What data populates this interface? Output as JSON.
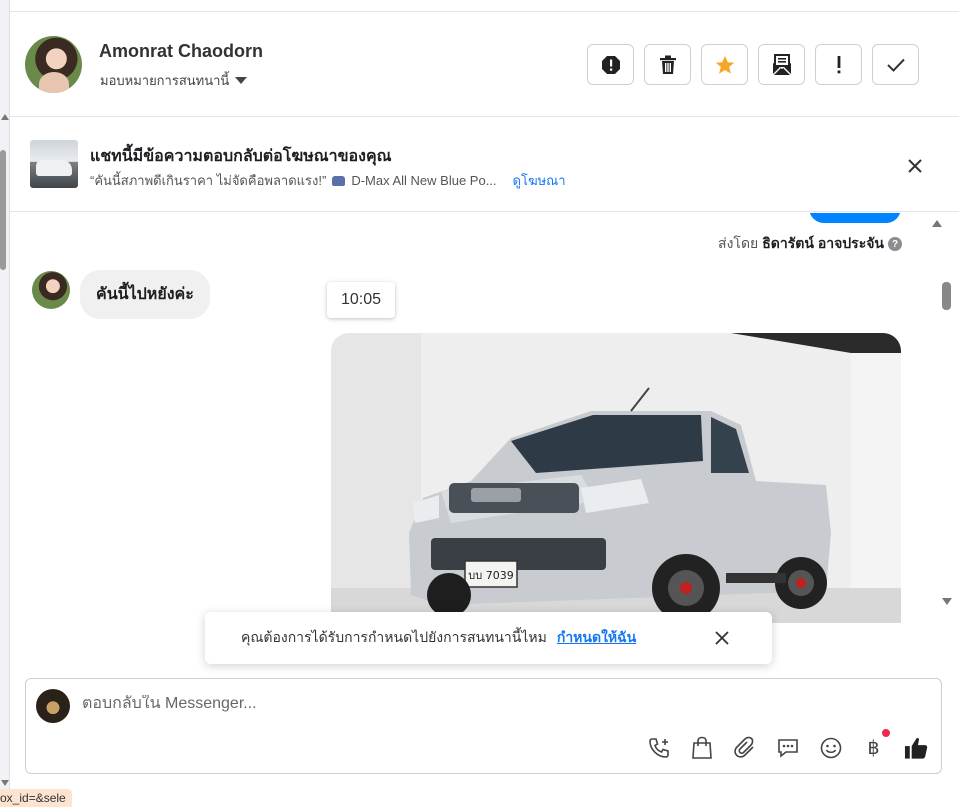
{
  "header": {
    "contact_name": "Amonrat Chaodorn",
    "assign_label": "มอบหมายการสนทนานี้",
    "actions": [
      {
        "icon": "alert-octagon-icon",
        "name": "action-alert-button"
      },
      {
        "icon": "trash-icon",
        "name": "action-delete-button"
      },
      {
        "icon": "star-icon",
        "name": "action-star-button",
        "color": "#f5a623"
      },
      {
        "icon": "envelope-open-icon",
        "name": "action-mark-unread-button"
      },
      {
        "icon": "exclamation-icon",
        "name": "action-important-button"
      },
      {
        "icon": "check-icon",
        "name": "action-done-button"
      }
    ]
  },
  "ad_banner": {
    "title": "แชทนี้มีข้อความตอบกลับต่อโฆษณาของคุณ",
    "ad_text": "“คันนี้สภาพดีเกินราคา ไม่จัดคือพลาดแรง!”",
    "ad_car_text": "D-Max All New Blue Po...",
    "view_ad_link": "ดูโฆษณา"
  },
  "chat": {
    "sent_by_prefix": "ส่งโดย",
    "sent_by_name": "ธิดารัตน์ อาจประจัน",
    "received_message": "คันนี้ไปหยังค่ะ",
    "timestamp": "10:05",
    "plate_text": "บบ 7039"
  },
  "toast": {
    "question": "คุณต้องการได้รับการกำหนดไปยังการสนทนานี้ไหม",
    "assign_link": "กำหนดให้ฉัน"
  },
  "composer": {
    "placeholder": "ตอบกลับใน Messenger...",
    "tools": [
      "phone-plus-icon",
      "shopping-bag-icon",
      "paperclip-icon",
      "chat-bubble-icon",
      "smiley-icon",
      "baht-icon",
      "thumbs-up-icon"
    ],
    "baht_symbol": "฿"
  },
  "status_bar": {
    "url_fragment": "ox_id=&sele"
  },
  "colors": {
    "accent": "#1877f2",
    "messenger_blue": "#0084ff",
    "star": "#f5a623",
    "notification": "#f02849"
  }
}
